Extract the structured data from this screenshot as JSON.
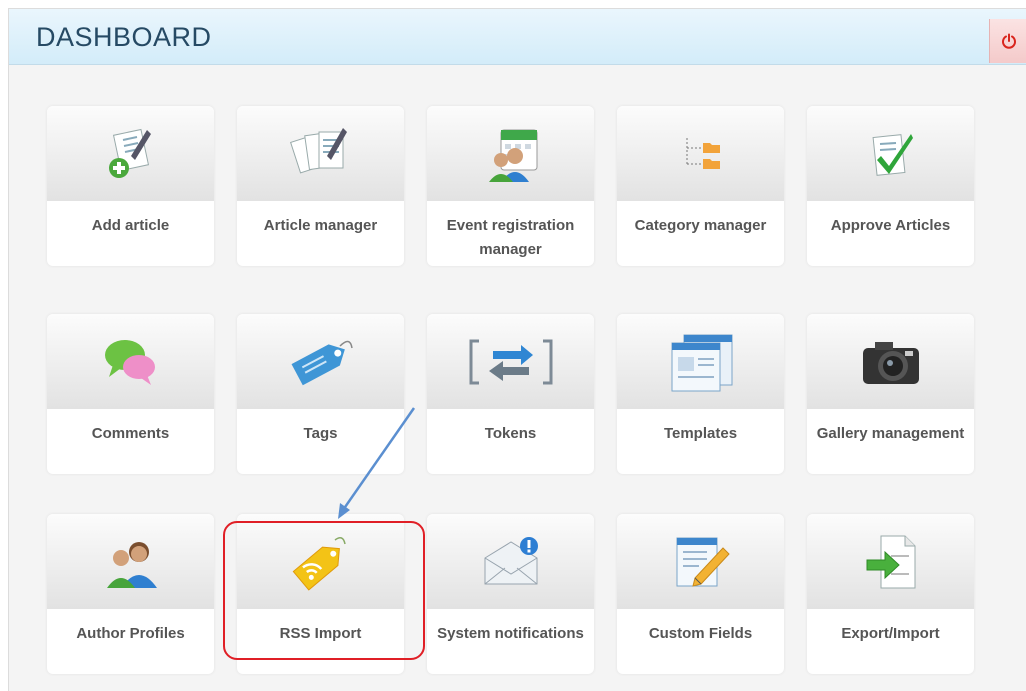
{
  "header": {
    "title": "DASHBOARD",
    "power_icon": "power-icon",
    "colors": {
      "header_bg": "#d3ecf9",
      "title": "#264a64",
      "power": "#d9251d"
    }
  },
  "tiles": [
    {
      "label": "Add article",
      "icon": "add-article-icon"
    },
    {
      "label": "Article manager",
      "icon": "article-manager-icon"
    },
    {
      "label": "Event registration manager",
      "icon": "event-registration-icon"
    },
    {
      "label": "Category manager",
      "icon": "category-tree-icon"
    },
    {
      "label": "Approve Articles",
      "icon": "approve-check-icon"
    },
    {
      "label": "Comments",
      "icon": "comments-icon"
    },
    {
      "label": "Tags",
      "icon": "tag-icon"
    },
    {
      "label": "Tokens",
      "icon": "tokens-icon"
    },
    {
      "label": "Templates",
      "icon": "templates-icon"
    },
    {
      "label": "Gallery management",
      "icon": "camera-icon"
    },
    {
      "label": "Author Profiles",
      "icon": "author-profiles-icon"
    },
    {
      "label": "RSS Import",
      "icon": "rss-tag-icon"
    },
    {
      "label": "System notifications",
      "icon": "envelope-alert-icon"
    },
    {
      "label": "Custom Fields",
      "icon": "custom-fields-icon"
    },
    {
      "label": "Export/Import",
      "icon": "export-import-icon"
    }
  ],
  "annotation": {
    "highlight_color": "#e01f26",
    "arrow_color": "#5b8fd0"
  }
}
